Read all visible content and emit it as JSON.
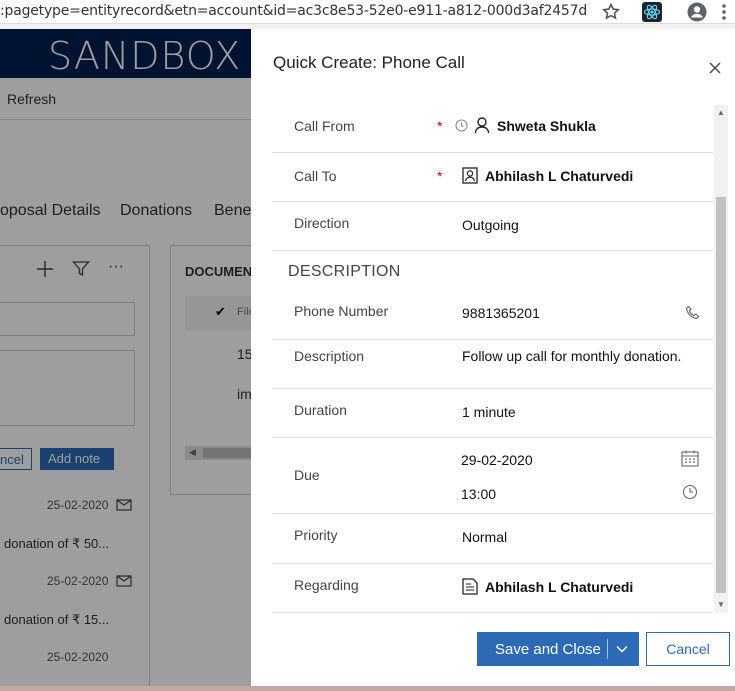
{
  "browser": {
    "url": ":pagetype=entityrecord&etn=account&id=ac3c8e53-52e0-e911-a812-000d3af2457d",
    "icons": [
      "star-icon",
      "react-devtools-icon",
      "account-icon",
      "kebab-menu-icon"
    ]
  },
  "background": {
    "logo": "SANDBOX",
    "command": "Refresh",
    "tabs": [
      "oposal Details",
      "Donations",
      "Benef"
    ],
    "documents_header": "DOCUMEN",
    "file_col": "File",
    "doc_rows": [
      "15",
      "im"
    ],
    "cancel_label": "ncel",
    "add_note_label": "Add note",
    "timeline": [
      {
        "date": "25-02-2020",
        "text": "donation of ₹ 50..."
      },
      {
        "date": "25-02-2020",
        "text": "donation of ₹ 15..."
      },
      {
        "date": "25-02-2020",
        "text": ""
      }
    ]
  },
  "dialog": {
    "title": "Quick Create: Phone Call",
    "section_title": "DESCRIPTION",
    "fields": {
      "call_from": {
        "label": "Call From",
        "value": "Shweta Shukla",
        "required": "*"
      },
      "call_to": {
        "label": "Call To",
        "value": "Abhilash L Chaturvedi",
        "required": "*"
      },
      "direction": {
        "label": "Direction",
        "value": "Outgoing"
      },
      "phone_number": {
        "label": "Phone Number",
        "value": "9881365201"
      },
      "description": {
        "label": "Description",
        "value": "Follow up call for monthly donation."
      },
      "duration": {
        "label": "Duration",
        "value": "1 minute"
      },
      "due": {
        "label": "Due",
        "date": "29-02-2020",
        "time": "13:00"
      },
      "priority": {
        "label": "Priority",
        "value": "Normal"
      },
      "regarding": {
        "label": "Regarding",
        "value": "Abhilash L Chaturvedi"
      }
    },
    "buttons": {
      "save": "Save and Close",
      "cancel": "Cancel"
    }
  },
  "colors": {
    "primary": "#2c6ab5",
    "banner": "#002050",
    "required": "#d00000"
  }
}
